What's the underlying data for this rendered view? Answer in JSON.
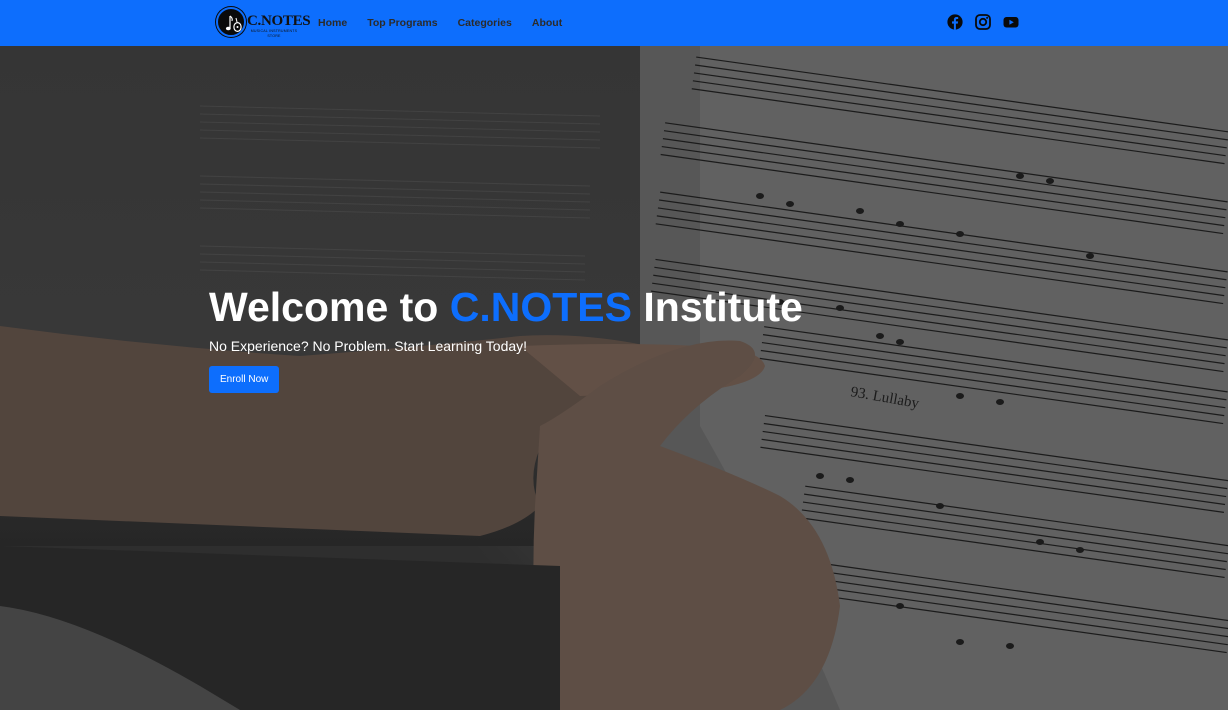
{
  "navbar": {
    "logo": {
      "brand": "C.NOTES",
      "tagline": "MUSICAL INSTRUMENTS STORE",
      "icon": "guitar-music-logo-icon"
    },
    "links": [
      "Home",
      "Top Programs",
      "Categories",
      "About"
    ],
    "socials": [
      {
        "name": "facebook-icon"
      },
      {
        "name": "instagram-icon"
      },
      {
        "name": "youtube-icon"
      }
    ]
  },
  "hero": {
    "title_prefix": "Welcome to ",
    "title_accent": "C.NOTES",
    "title_suffix": " Institute",
    "subtitle": "No Experience? No Problem. Start Learning Today!",
    "cta_label": "Enroll Now",
    "sheet_caption": "93. Lullaby",
    "background": "sheet-music-hands-photo"
  },
  "colors": {
    "accent": "#0d6efd",
    "nav_text": "#2b2b2b",
    "hero_text": "#ffffff"
  }
}
